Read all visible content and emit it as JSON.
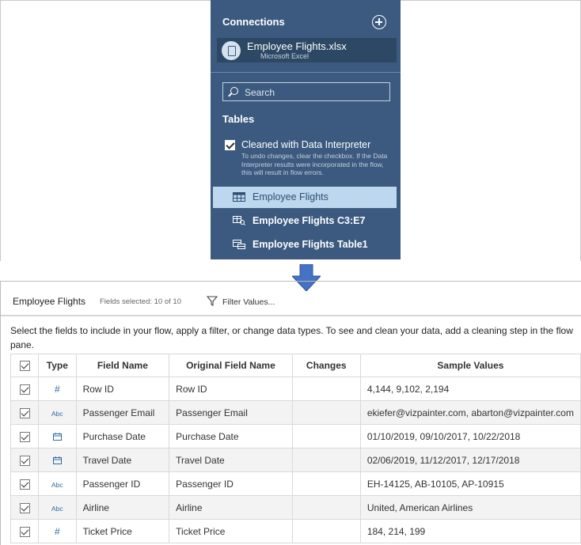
{
  "panel": {
    "connections_title": "Connections",
    "connection": {
      "name": "Employee Flights.xlsx",
      "type": "Microsoft Excel"
    },
    "search_placeholder": "Search",
    "tables_title": "Tables",
    "data_interpreter": {
      "label": "Cleaned with Data Interpreter",
      "checked": true,
      "note": "To undo changes, clear the checkbox. If the Data Interpreter results were incorporated in the flow, this will result in flow errors."
    },
    "tables": [
      {
        "label": "Employee Flights",
        "icon": "table-icon",
        "selected": true
      },
      {
        "label": "Employee Flights C3:E7",
        "icon": "sub-table-icon",
        "selected": false
      },
      {
        "label": "Employee Flights Table1",
        "icon": "named-table-icon",
        "selected": false
      }
    ]
  },
  "arrow_color": "#4472c4",
  "grid_header": {
    "title": "Employee Flights",
    "fields_selected": "Fields selected: 10 of 10",
    "filter_label": "Filter Values..."
  },
  "instructions": "Select the fields to include in your flow, apply a filter, or change data types. To see and clean your data, add a cleaning step in the flow pane.",
  "columns": [
    "Type",
    "Field Name",
    "Original Field Name",
    "Changes",
    "Sample Values"
  ],
  "rows": [
    {
      "type": "#",
      "field": "Row ID",
      "original": "Row ID",
      "changes": "",
      "samples": "4,144, 9,102, 2,194"
    },
    {
      "type": "Abc",
      "field": "Passenger Email",
      "original": "Passenger Email",
      "changes": "",
      "samples": "ekiefer@vizpainter.com, abarton@vizpainter.com"
    },
    {
      "type": "date",
      "field": "Purchase Date",
      "original": "Purchase Date",
      "changes": "",
      "samples": "01/10/2019, 09/10/2017, 10/22/2018"
    },
    {
      "type": "date",
      "field": "Travel Date",
      "original": "Travel Date",
      "changes": "",
      "samples": "02/06/2019, 11/12/2017, 12/17/2018"
    },
    {
      "type": "Abc",
      "field": "Passenger ID",
      "original": "Passenger ID",
      "changes": "",
      "samples": "EH-14125, AB-10105, AP-10915"
    },
    {
      "type": "Abc",
      "field": "Airline",
      "original": "Airline",
      "changes": "",
      "samples": "United, American Airlines"
    },
    {
      "type": "#",
      "field": "Ticket Price",
      "original": "Ticket Price",
      "changes": "",
      "samples": "184, 214, 199"
    }
  ]
}
